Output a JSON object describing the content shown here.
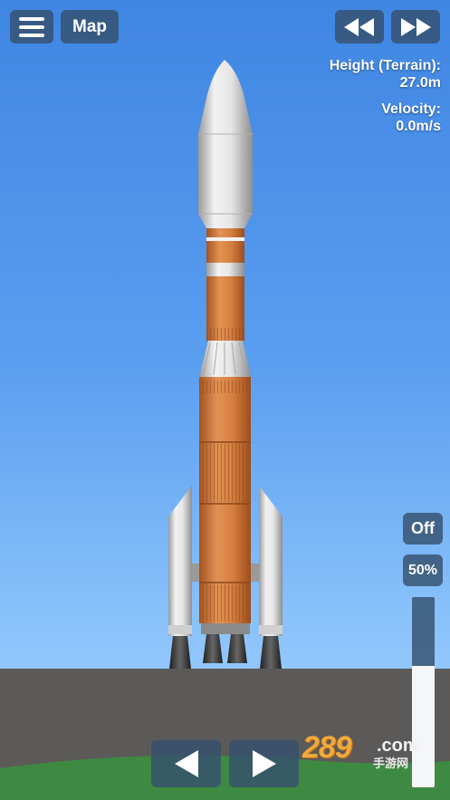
{
  "top_bar": {
    "menu_icon": "hamburger-menu-icon",
    "map_label": "Map",
    "rewind_icon": "rewind-icon",
    "fast_forward_icon": "fast-forward-icon"
  },
  "telemetry": {
    "height_label": "Height (Terrain):",
    "height_value": "27.0m",
    "velocity_label": "Velocity:",
    "velocity_value": "0.0m/s"
  },
  "throttle": {
    "toggle_label": "Off",
    "percent_label": "50%",
    "level": 0.64
  },
  "controls": {
    "rotate_left_icon": "triangle-left-icon",
    "rotate_right_icon": "triangle-right-icon"
  },
  "watermark": {
    "number": "289",
    "domain": ".com",
    "chinese": "手游网"
  },
  "colors": {
    "sky_top": "#3f86e3",
    "sky_bottom": "#a8d4fc",
    "ground": "#5c5b5a",
    "grass": "#3d8440",
    "button_bg": "#34506e",
    "rocket_orange": "#d47a3c",
    "rocket_white": "#e8e8e8"
  }
}
